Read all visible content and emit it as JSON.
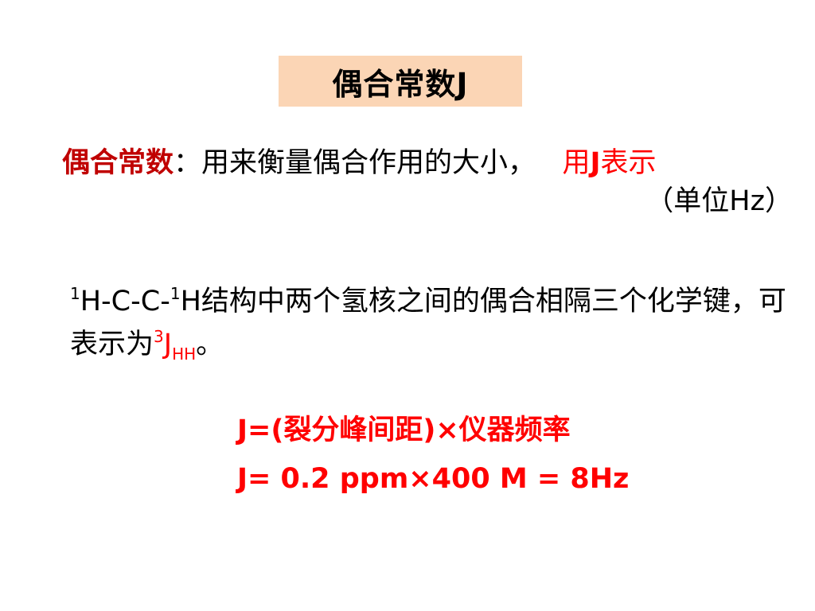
{
  "slide": {
    "title": "偶合常数J",
    "definition": {
      "term": "偶合常数",
      "colon": "：",
      "text": "用来衡量偶合作用的大小，",
      "notation_prefix": "用",
      "notation_symbol": "J",
      "notation_suffix": "表示",
      "unit": "（单位Hz）"
    },
    "paragraph": {
      "sup1": "1",
      "part1": "H-C-C-",
      "sup2": "1",
      "part2": "H结构中两个氢核之间的偶合相隔三个化学键，可表示为",
      "sup3": "3",
      "symbol": "J",
      "subscript": "HH",
      "end": "。"
    },
    "formula_1": "J=(裂分峰间距)×仪器频率",
    "formula_2": "J= 0.2 ppm×400 M = 8Hz"
  },
  "colors": {
    "title_background": "#fbd5b5",
    "term_red": "#c00000",
    "highlight_red": "#ff0000"
  }
}
